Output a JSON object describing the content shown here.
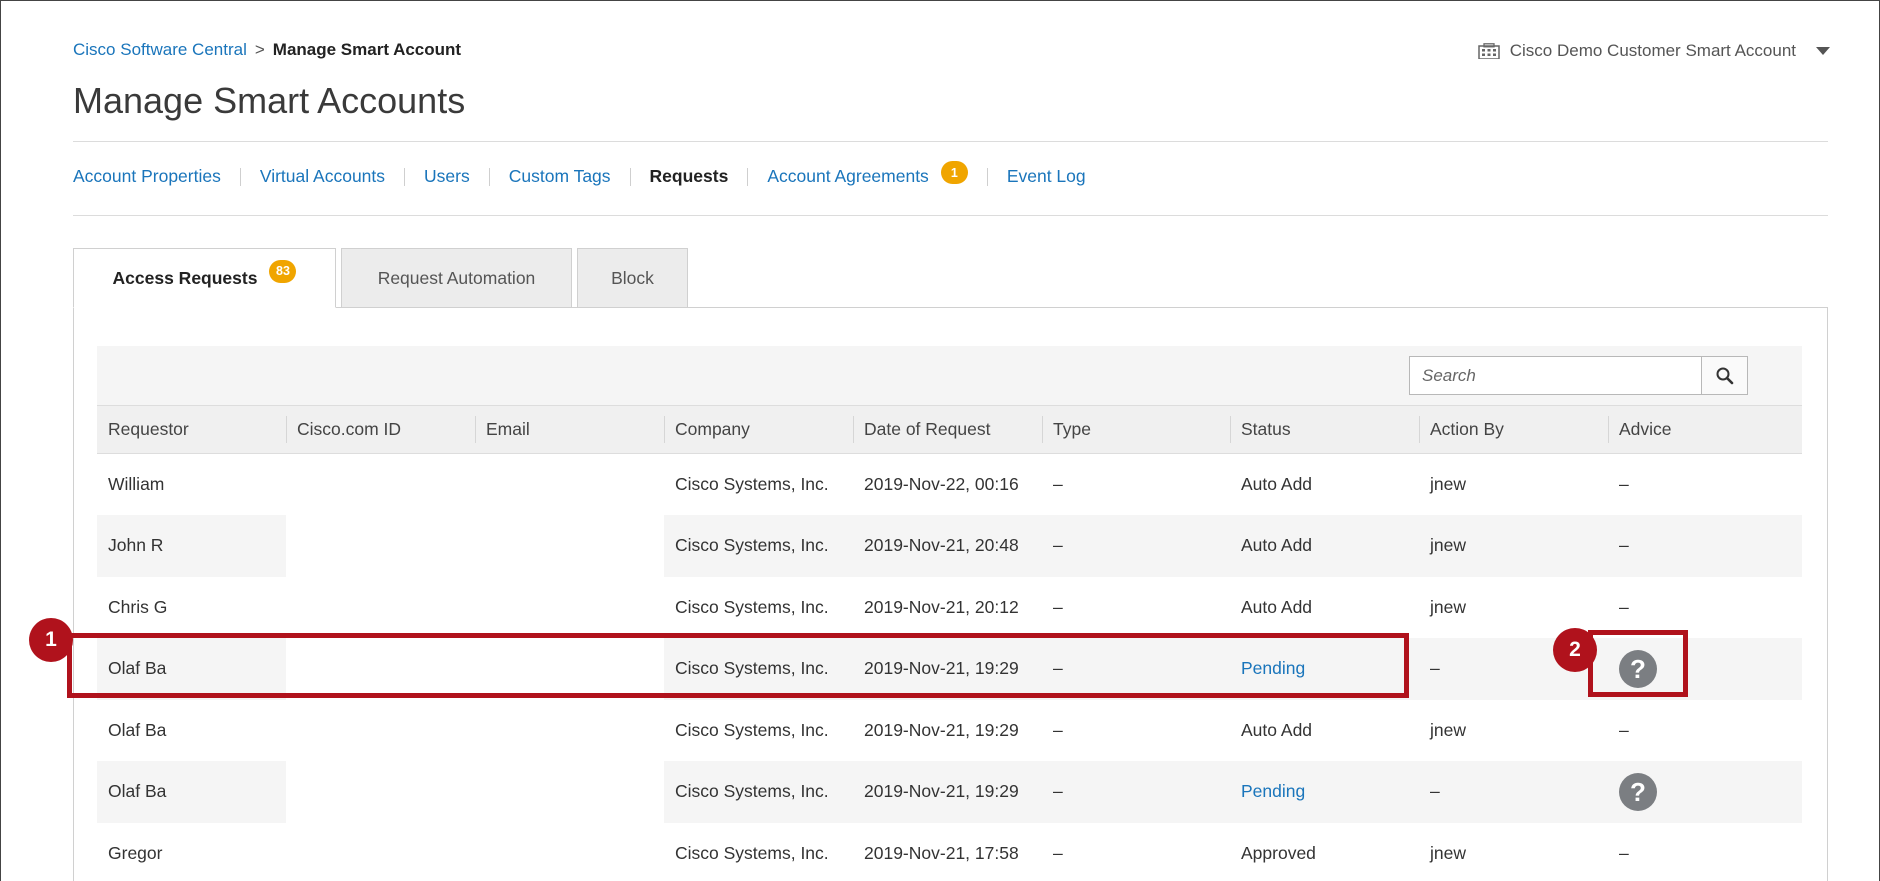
{
  "breadcrumb": {
    "root": "Cisco Software Central",
    "separator": ">",
    "current": "Manage Smart Account"
  },
  "account_switcher": {
    "label": "Cisco Demo Customer Smart Account",
    "icon": "building-icon"
  },
  "page": {
    "title": "Manage Smart Accounts"
  },
  "subnav": {
    "items": [
      {
        "label": "Account Properties"
      },
      {
        "label": "Virtual Accounts"
      },
      {
        "label": "Users"
      },
      {
        "label": "Custom Tags"
      },
      {
        "label": "Requests"
      },
      {
        "label": "Account Agreements",
        "badge": "1"
      },
      {
        "label": "Event Log"
      }
    ],
    "active": "Requests"
  },
  "tabs": [
    {
      "label": "Access Requests",
      "badge": "83"
    },
    {
      "label": "Request Automation"
    },
    {
      "label": "Block"
    }
  ],
  "search": {
    "placeholder": "Search",
    "value": ""
  },
  "table": {
    "columns": [
      "Requestor",
      "Cisco.com ID",
      "Email",
      "Company",
      "Date of Request",
      "Type",
      "Status",
      "Action By",
      "Advice"
    ],
    "rows": [
      {
        "requestor": "William",
        "company": "Cisco Systems, Inc.",
        "date": "2019-Nov-22, 00:16",
        "type": "–",
        "status": "Auto Add",
        "action_by": "jnew",
        "advice": "–"
      },
      {
        "requestor": "John R",
        "company": "Cisco Systems, Inc.",
        "date": "2019-Nov-21, 20:48",
        "type": "–",
        "status": "Auto Add",
        "action_by": "jnew",
        "advice": "–"
      },
      {
        "requestor": "Chris G",
        "company": "Cisco Systems, Inc.",
        "date": "2019-Nov-21, 20:12",
        "type": "–",
        "status": "Auto Add",
        "action_by": "jnew",
        "advice": "–"
      },
      {
        "requestor": "Olaf Ba",
        "company": "Cisco Systems, Inc.",
        "date": "2019-Nov-21, 19:29",
        "type": "–",
        "status": "Pending",
        "action_by": "–",
        "advice": "?"
      },
      {
        "requestor": "Olaf Ba",
        "company": "Cisco Systems, Inc.",
        "date": "2019-Nov-21, 19:29",
        "type": "–",
        "status": "Auto Add",
        "action_by": "jnew",
        "advice": "–"
      },
      {
        "requestor": "Olaf Ba",
        "company": "Cisco Systems, Inc.",
        "date": "2019-Nov-21, 19:29",
        "type": "–",
        "status": "Pending",
        "action_by": "–",
        "advice": "?"
      },
      {
        "requestor": "Gregor",
        "company": "Cisco Systems, Inc.",
        "date": "2019-Nov-21, 17:58",
        "type": "–",
        "status": "Approved",
        "action_by": "jnew",
        "advice": "–"
      }
    ]
  },
  "callouts": [
    {
      "number": "1"
    },
    {
      "number": "2"
    }
  ],
  "colors": {
    "link": "#1a75bb",
    "badge": "#f0a500",
    "callout": "#b0121c",
    "help_icon": "#7b7e82"
  }
}
